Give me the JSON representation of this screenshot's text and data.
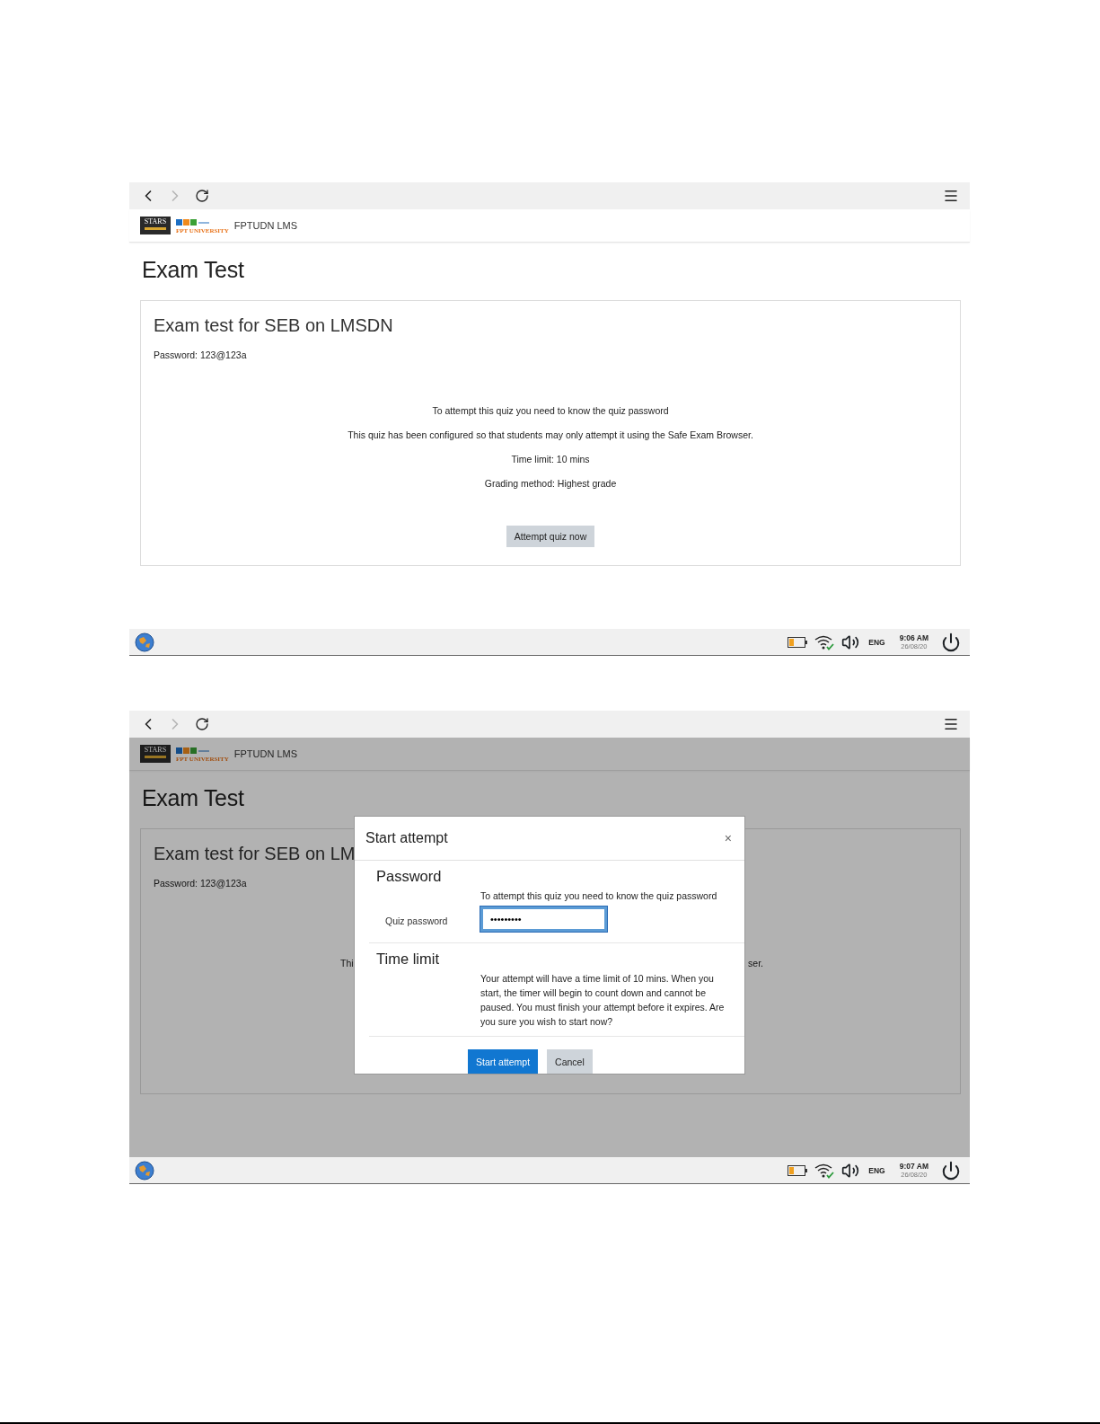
{
  "screenshot_1": {
    "navigation": [
      {
        "kind": "back",
        "disabled": false
      },
      {
        "kind": "forward",
        "disabled": true
      },
      {
        "kind": "reload",
        "disabled": false
      }
    ],
    "logos": {
      "stars": "STARS",
      "fpt": "FPT UNIVERSITY"
    },
    "site_name": "FPTUDN LMS",
    "page_title": "Exam Test",
    "card": {
      "title": "Exam test for SEB on LMSDN",
      "note": "Password: 123@123a",
      "info": [
        "To attempt this quiz you need to know the quiz password",
        "This quiz has been configured so that students may only attempt it using the Safe Exam Browser.",
        "Time limit: 10 mins",
        "Grading method: Highest grade"
      ],
      "button": "Attempt quiz now"
    },
    "taskbar": {
      "language": "ENG",
      "time": "9:06 AM",
      "date": "26/08/20"
    }
  },
  "screenshot_2": {
    "navigation": [
      {
        "kind": "back",
        "disabled": false
      },
      {
        "kind": "forward",
        "disabled": true
      },
      {
        "kind": "reload",
        "disabled": false
      }
    ],
    "logos": {
      "stars": "STARS",
      "fpt": "FPT UNIVERSITY"
    },
    "site_name": "FPTUDN LMS",
    "page_title": "Exam Test",
    "card": {
      "title": "Exam test for SEB on LM",
      "note": "Password: 123@123a",
      "info_fragments": [
        "Thi",
        "ser."
      ]
    },
    "dialog": {
      "title": "Start attempt",
      "close": "×",
      "sections": [
        {
          "heading": "Password",
          "text": "To attempt this quiz you need to know the quiz password",
          "field_label": "Quiz password",
          "field_value": "•••••••••"
        },
        {
          "heading": "Time limit",
          "text": "Your attempt will have a time limit of 10 mins. When you start, the timer will begin to count down and cannot be paused. You must finish your attempt before it expires. Are you sure you wish to start now?"
        }
      ],
      "buttons": [
        {
          "label": "Start attempt",
          "kind": "primary"
        },
        {
          "label": "Cancel",
          "kind": "secondary"
        }
      ]
    },
    "taskbar": {
      "language": "ENG",
      "time": "9:07 AM",
      "date": "26/08/20"
    }
  }
}
